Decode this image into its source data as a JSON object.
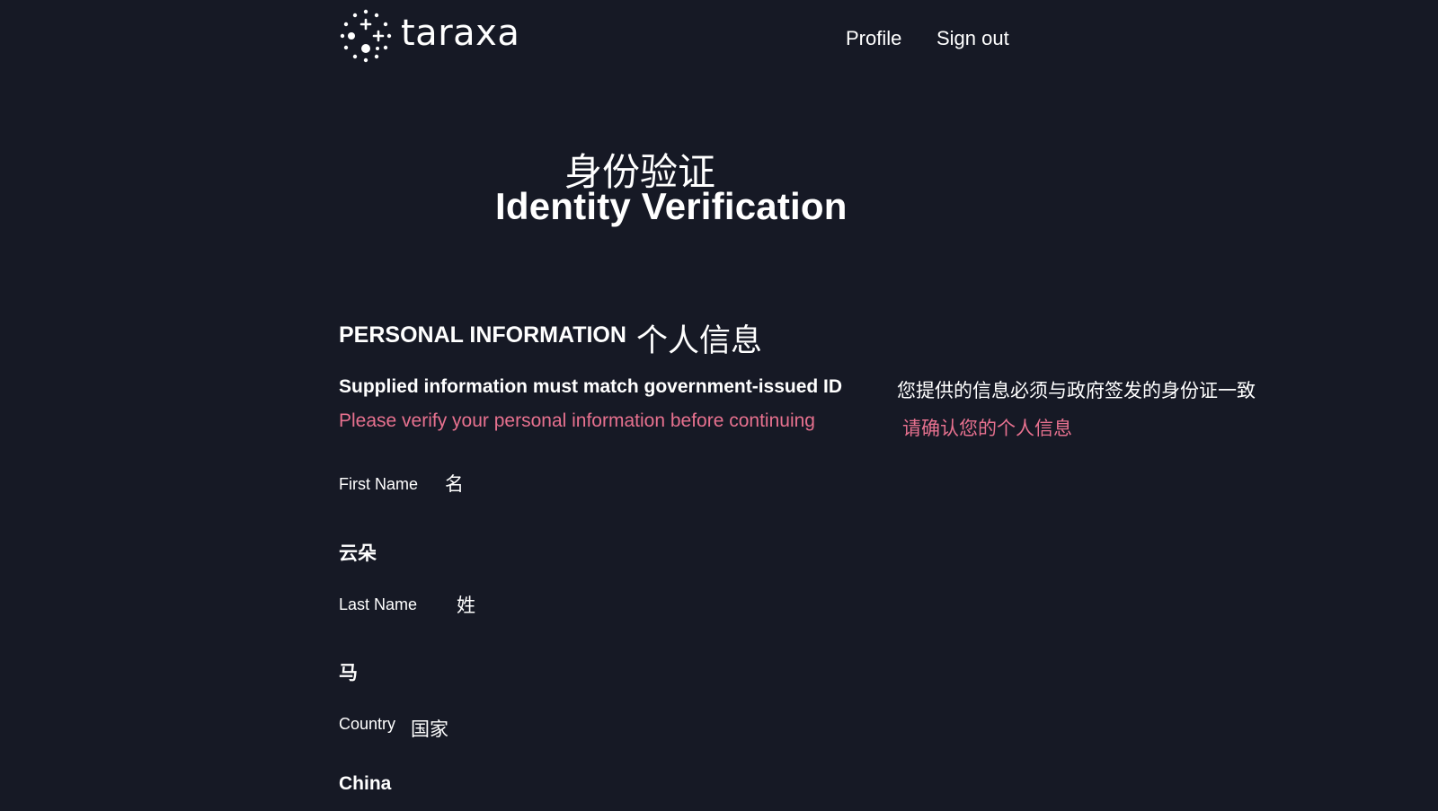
{
  "header": {
    "logo_text": "taraxa",
    "nav": {
      "profile": "Profile",
      "sign_out": "Sign out"
    }
  },
  "page": {
    "title_cn": "身份验证",
    "title_en": "Identity Verification"
  },
  "section": {
    "title_en": "PERSONAL INFORMATION",
    "title_cn": "个人信息",
    "notice_en": "Supplied information must match government-issued ID",
    "notice_cn": "您提供的信息必须与政府签发的身份证一致",
    "warning_en": "Please verify your personal information before continuing",
    "warning_cn": "请确认您的个人信息"
  },
  "fields": {
    "first_name": {
      "label_en": "First Name",
      "label_cn": "名",
      "value": "云朵"
    },
    "last_name": {
      "label_en": "Last Name",
      "label_cn": "姓",
      "value": "马"
    },
    "country": {
      "label_en": "Country",
      "label_cn": "国家",
      "value": "China"
    }
  },
  "colors": {
    "background": "#161925",
    "text": "#ffffff",
    "warning": "#e7718f"
  }
}
